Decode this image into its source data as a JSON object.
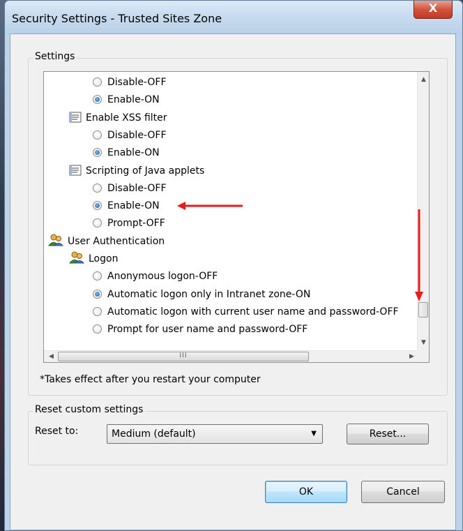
{
  "window": {
    "title": "Security Settings - Trusted Sites Zone",
    "close_glyph": "X"
  },
  "settings_group": {
    "legend": "Settings",
    "list": [
      {
        "kind": "radio",
        "label": "Disable-OFF",
        "checked": false,
        "indent": 2
      },
      {
        "kind": "radio",
        "label": "Enable-ON",
        "checked": true,
        "indent": 2
      },
      {
        "kind": "setting",
        "label": "Enable XSS filter",
        "icon": "script-setting-icon",
        "indent": 1
      },
      {
        "kind": "radio",
        "label": "Disable-OFF",
        "checked": false,
        "indent": 2
      },
      {
        "kind": "radio",
        "label": "Enable-ON",
        "checked": true,
        "indent": 2
      },
      {
        "kind": "setting",
        "label": "Scripting of Java applets",
        "icon": "script-setting-icon",
        "indent": 1
      },
      {
        "kind": "radio",
        "label": "Disable-OFF",
        "checked": false,
        "indent": 2
      },
      {
        "kind": "radio",
        "label": "Enable-ON",
        "checked": true,
        "indent": 2
      },
      {
        "kind": "radio",
        "label": "Prompt-OFF",
        "checked": false,
        "indent": 2
      },
      {
        "kind": "category",
        "label": "User Authentication",
        "icon": "users-icon",
        "indent": 0
      },
      {
        "kind": "setting",
        "label": "Logon",
        "icon": "users-icon",
        "indent": 1
      },
      {
        "kind": "radio",
        "label": "Anonymous logon-OFF",
        "checked": false,
        "indent": 2
      },
      {
        "kind": "radio",
        "label": "Automatic logon only in Intranet zone-ON",
        "checked": true,
        "indent": 2
      },
      {
        "kind": "radio",
        "label": "Automatic logon with current user name and password-OFF",
        "checked": false,
        "indent": 2
      },
      {
        "kind": "radio",
        "label": "Prompt for user name and password-OFF",
        "checked": false,
        "indent": 2
      }
    ],
    "note": "*Takes effect after you restart your computer",
    "scroll_position": 0.92
  },
  "reset_group": {
    "legend": "Reset custom settings",
    "reset_to_label": "Reset to:",
    "selected_level": "Medium (default)",
    "reset_button": "Reset..."
  },
  "buttons": {
    "ok": "OK",
    "cancel": "Cancel"
  },
  "colors": {
    "annotation_arrow": "#e41c1c",
    "radio_checked": "#1e5a9a"
  },
  "hscroll_thumb_glyph": "III"
}
